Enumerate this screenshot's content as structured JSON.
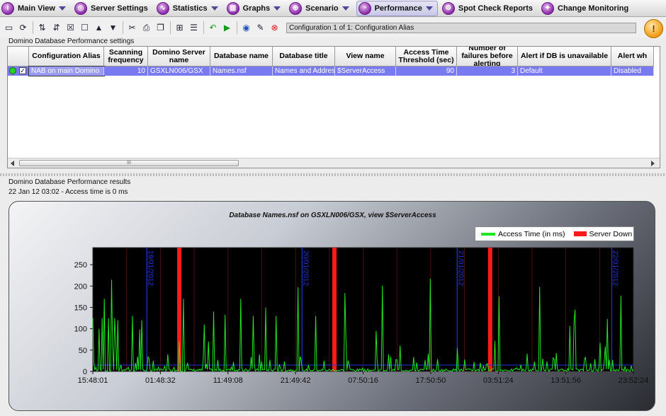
{
  "menu": [
    {
      "label": "Main View",
      "icon": "info-icon",
      "caret": true,
      "active": false
    },
    {
      "label": "Server Settings",
      "icon": "server-settings-icon",
      "caret": false,
      "active": false
    },
    {
      "label": "Statistics",
      "icon": "statistics-icon",
      "caret": true,
      "active": false
    },
    {
      "label": "Graphs",
      "icon": "graphs-icon",
      "caret": true,
      "active": false
    },
    {
      "label": "Scenario",
      "icon": "globe-icon",
      "caret": true,
      "active": false
    },
    {
      "label": "Performance",
      "icon": "performance-icon",
      "caret": true,
      "active": true
    },
    {
      "label": "Spot Check Reports",
      "icon": "spot-check-icon",
      "caret": false,
      "active": false
    },
    {
      "label": "Change Monitoring",
      "icon": "change-monitoring-icon",
      "caret": false,
      "active": false
    }
  ],
  "toolbar": {
    "config_selector": "Configuration 1 of 1: Configuration Alias"
  },
  "settings": {
    "section_label": "Domino Database Performance settings",
    "columns": [
      "Configuration Alias",
      "Scanning frequency",
      "Domino Server name",
      "Database name",
      "Database title",
      "View name",
      "Access Time Threshold (sec)",
      "Number of failures before alerting",
      "Alert if DB is unavailable",
      "Alert wh"
    ],
    "rows": [
      {
        "checked": "✓",
        "values": [
          "NAB on main Domino",
          "10",
          "GSXLN006/GSX",
          "Names.nsf",
          "Names and Addres",
          "$ServerAccess",
          "90",
          "3",
          "Default",
          "Disabled"
        ]
      }
    ],
    "scroll_grip": "III"
  },
  "results": {
    "section_label": "Domino Database Performance results",
    "status_line": "22 Jan 12 03:02 - Access time is 0 ms"
  },
  "colors": {
    "access_line": "#22e622",
    "server_down": "#ff1a1a",
    "day_marker": "#2233dd",
    "selected_row": "#7a7af0"
  },
  "chart_data": {
    "type": "line",
    "title": "Database Names.nsf on GSXLN006/GSX, view $ServerAccess",
    "legend": [
      {
        "name": "Access Time (in ms)",
        "color": "#22e622"
      },
      {
        "name": "Server Down",
        "color": "#ff1a1a"
      }
    ],
    "legend_position": "top-right",
    "x_tick_labels": [
      "15:48:01",
      "01:48:32",
      "11:49:08",
      "21:49:42",
      "07:50:16",
      "17:50:50",
      "03:51:24",
      "13:51:56",
      "23:52:24"
    ],
    "y_ticks": [
      0,
      50,
      100,
      150,
      200,
      250
    ],
    "ylim": [
      0,
      290
    ],
    "day_markers": [
      "19/01/2012",
      "20/01/2012",
      "21/01/2012",
      "22/01/2012"
    ],
    "day_marker_positions": [
      0.1,
      0.387,
      0.674,
      0.96
    ],
    "server_down_positions": [
      0.16,
      0.447,
      0.735
    ],
    "threshold_value": 15,
    "series": [
      {
        "name": "Access Time (in ms)",
        "values": [
          125,
          20,
          0,
          10,
          0,
          0,
          100,
          0,
          0,
          125,
          0,
          170,
          0,
          0,
          0,
          125,
          0,
          0,
          0,
          60,
          0,
          125,
          0,
          0,
          120,
          0,
          0,
          15,
          0,
          0,
          0,
          0,
          0,
          0,
          10,
          0,
          0,
          0,
          130,
          0,
          0,
          20,
          0,
          35,
          0,
          0,
          0,
          120,
          0,
          0,
          0,
          0,
          0,
          0,
          0,
          0,
          0,
          0,
          25,
          0,
          0,
          0,
          0,
          10,
          0,
          0,
          0,
          0,
          0,
          0,
          0,
          0,
          40,
          0,
          0,
          0,
          0,
          0,
          0,
          0,
          0,
          0,
          0,
          70,
          0,
          0,
          0,
          170,
          0,
          0,
          10,
          20,
          0,
          0,
          0,
          0,
          0,
          0,
          0,
          0,
          0,
          0,
          0,
          0,
          0,
          0,
          0,
          110,
          0,
          0,
          0,
          70,
          0,
          0,
          0,
          0,
          0,
          0,
          0,
          0,
          0,
          0,
          0,
          0,
          0,
          0,
          0,
          0,
          0,
          0,
          0,
          0,
          0,
          0,
          0,
          0,
          0,
          0,
          0,
          0,
          0,
          0,
          170,
          0,
          0,
          0,
          0,
          0,
          0,
          0,
          0,
          0,
          0,
          0,
          130,
          0,
          0,
          0,
          0,
          0,
          40,
          0,
          0,
          0,
          0,
          0,
          0,
          0,
          0,
          0,
          0,
          0,
          0,
          0,
          0,
          0,
          130,
          0,
          0,
          0,
          10,
          0,
          0,
          0,
          0,
          0,
          0,
          0,
          0,
          0,
          0,
          0,
          0,
          0,
          0,
          0,
          0,
          0,
          0,
          0,
          0,
          0,
          0,
          0,
          0,
          0,
          0,
          15,
          0,
          0,
          0,
          0,
          0,
          0,
          130,
          0,
          0,
          0,
          0,
          0,
          0,
          0,
          0,
          0,
          0,
          0,
          0,
          0,
          0,
          0,
          0,
          0,
          0,
          0,
          0,
          0,
          0,
          0,
          0,
          0,
          0,
          0,
          0,
          0,
          0,
          0,
          0,
          0,
          0,
          0,
          0,
          0,
          0,
          0,
          0,
          0,
          0,
          0,
          0,
          0,
          0,
          0,
          0,
          0,
          0,
          0,
          0,
          0,
          0,
          0,
          0,
          0,
          0,
          0,
          0,
          0,
          0,
          0,
          0,
          0,
          0,
          0,
          0,
          0,
          0,
          0,
          0,
          0,
          0,
          0,
          0,
          0,
          0,
          0,
          0,
          0,
          0,
          0,
          0,
          0,
          0,
          0,
          0,
          0,
          0,
          0,
          0,
          0,
          0,
          0,
          0,
          0,
          0,
          0,
          0,
          0,
          0,
          0,
          0,
          0,
          0,
          0,
          0,
          0,
          0,
          0,
          0,
          0,
          0,
          0,
          0,
          0,
          0,
          0,
          0,
          0,
          0,
          0,
          0,
          0,
          0,
          0,
          0,
          0,
          0,
          0,
          0,
          0,
          0,
          0,
          0,
          0,
          0,
          0,
          0,
          0,
          0,
          0,
          0,
          0,
          0,
          0,
          0,
          0,
          0,
          0,
          0,
          0,
          0,
          0,
          0,
          0,
          0,
          0,
          0,
          0,
          0,
          0,
          0,
          0,
          0,
          0,
          0,
          0,
          0,
          0,
          0,
          0,
          0,
          0,
          0,
          0,
          0,
          0,
          0,
          0,
          0,
          0,
          0,
          0,
          0,
          0,
          0,
          0,
          0,
          0,
          0,
          0,
          0,
          0,
          0,
          0,
          0,
          0,
          0,
          0,
          0,
          0,
          0,
          0,
          0,
          0,
          0,
          0,
          0,
          0,
          0,
          0,
          0,
          0,
          0,
          0,
          0,
          0,
          0,
          0,
          0,
          0,
          0,
          0,
          0,
          0,
          0,
          0,
          0,
          0,
          0,
          0,
          0,
          0,
          0,
          0,
          0,
          0,
          0,
          0,
          0,
          0,
          0,
          0,
          0,
          0,
          0,
          0,
          0,
          0,
          0,
          0,
          0,
          0,
          0,
          0,
          0,
          0,
          0,
          0,
          0,
          0,
          0,
          0,
          0,
          0,
          0,
          0,
          0,
          0,
          0,
          0,
          0,
          0,
          0,
          0,
          0,
          0,
          0,
          0,
          0,
          0,
          0,
          0,
          0,
          0,
          0,
          0,
          0,
          0,
          0,
          0,
          0,
          0,
          0,
          0,
          0,
          0,
          0,
          0,
          0,
          0,
          0,
          0,
          0,
          0,
          0,
          0,
          0,
          0,
          0,
          0,
          0,
          0,
          0,
          0,
          0,
          0,
          0,
          0,
          0,
          0,
          0,
          0,
          0,
          0,
          0,
          0,
          0,
          0,
          0,
          0,
          0,
          0,
          0,
          0,
          0,
          0,
          0,
          0,
          0,
          0,
          0,
          0,
          0,
          0,
          0,
          0,
          0,
          0,
          0,
          0,
          0,
          0,
          0,
          0,
          0,
          0,
          0,
          0,
          0,
          0,
          0,
          0,
          0,
          0,
          0,
          0,
          0,
          0,
          0,
          0,
          0,
          0,
          0,
          0,
          0,
          0,
          0,
          0,
          0,
          0,
          0,
          0,
          0,
          0,
          0,
          0,
          0,
          0,
          0,
          0,
          0,
          0,
          0,
          0,
          0,
          0,
          0,
          0,
          0,
          0,
          0,
          0,
          0,
          0,
          0,
          0,
          0,
          0,
          0,
          0,
          0,
          0,
          0,
          0,
          0,
          0,
          0,
          0,
          0,
          0,
          0,
          0,
          0,
          0,
          0,
          0,
          0,
          0,
          0,
          0,
          0,
          0,
          0,
          0,
          0,
          0,
          0,
          0,
          0,
          0,
          0,
          0,
          0,
          0,
          0,
          0,
          0,
          0,
          0,
          0,
          0,
          0,
          0,
          0,
          0,
          0,
          0,
          0,
          0,
          0,
          0,
          0,
          0,
          0,
          0,
          0,
          0,
          0,
          0,
          0,
          0,
          0,
          0,
          0,
          0,
          0,
          0,
          0,
          0,
          0,
          0,
          0,
          0,
          0,
          0,
          0,
          0,
          0,
          0,
          0,
          0,
          0,
          0,
          0,
          0,
          0,
          0,
          0,
          0,
          0,
          0,
          0,
          0,
          0,
          0,
          0,
          0,
          0,
          0,
          0,
          0,
          0,
          0,
          0,
          0,
          0,
          0,
          0,
          0,
          0
        ]
      }
    ]
  }
}
